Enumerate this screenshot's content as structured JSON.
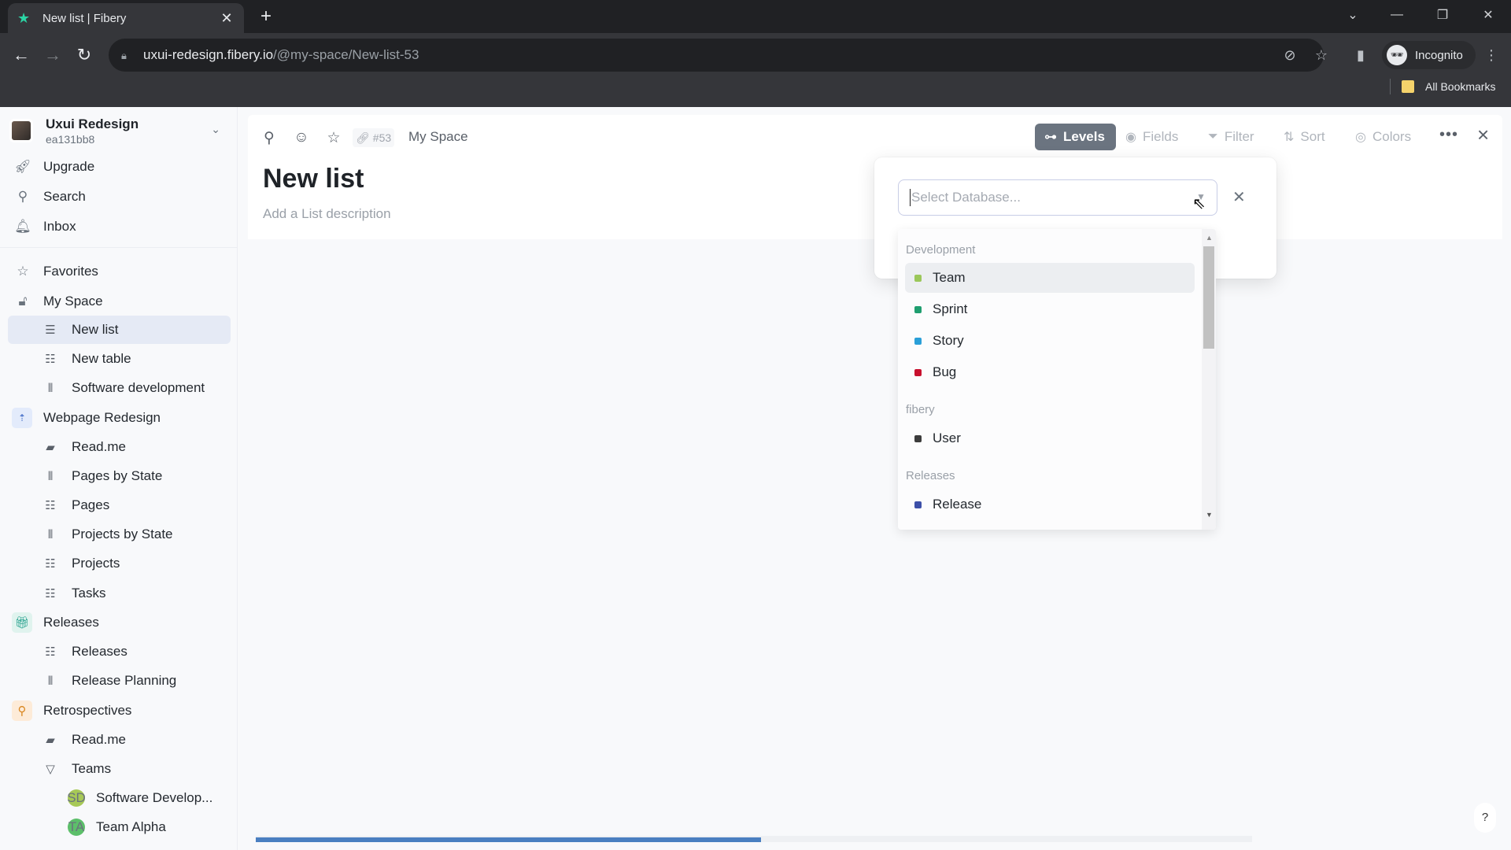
{
  "browser": {
    "tab_title": "New list | Fibery",
    "tab_favicon": "fibery-star-icon",
    "url_host": "uxui-redesign.fibery.io",
    "url_path": "/@my-space/New-list-53",
    "profile_label": "Incognito",
    "bookmarks_label": "All Bookmarks"
  },
  "sidebar": {
    "workspace_name": "Uxui Redesign",
    "workspace_id": "ea131bb8",
    "top_items": [
      {
        "label": "Upgrade",
        "icon": "rocket-icon"
      },
      {
        "label": "Search",
        "icon": "search-icon"
      },
      {
        "label": "Inbox",
        "icon": "bell-icon"
      }
    ],
    "items": [
      {
        "label": "Favorites",
        "icon": "star-icon",
        "level": 0
      },
      {
        "label": "My Space",
        "icon": "lock-icon",
        "level": 0
      },
      {
        "label": "New list",
        "icon": "list-icon",
        "level": 1,
        "active": true
      },
      {
        "label": "New table",
        "icon": "table-icon",
        "level": 1
      },
      {
        "label": "Software development",
        "icon": "board-icon",
        "level": 1
      },
      {
        "label": "Webpage Redesign",
        "icon": "space-icon",
        "level": 0
      },
      {
        "label": "Read.me",
        "icon": "document-icon",
        "level": 1
      },
      {
        "label": "Pages by State",
        "icon": "board-icon",
        "level": 1
      },
      {
        "label": "Pages",
        "icon": "table-icon",
        "level": 1
      },
      {
        "label": "Projects by State",
        "icon": "board-icon",
        "level": 1
      },
      {
        "label": "Projects",
        "icon": "table-icon",
        "level": 1
      },
      {
        "label": "Tasks",
        "icon": "table-icon",
        "level": 1
      },
      {
        "label": "Releases",
        "icon": "gift-icon",
        "level": 0
      },
      {
        "label": "Releases",
        "icon": "table-icon",
        "level": 1
      },
      {
        "label": "Release Planning",
        "icon": "board-icon",
        "level": 1
      },
      {
        "label": "Retrospectives",
        "icon": "retro-icon",
        "level": 0
      },
      {
        "label": "Read.me",
        "icon": "document-icon",
        "level": 1
      },
      {
        "label": "Teams",
        "icon": "triangle-down-icon",
        "level": 1
      },
      {
        "label": "Software Develop...",
        "icon": "avatar-SD",
        "initials": "SD",
        "level": 2
      },
      {
        "label": "Team Alpha",
        "icon": "avatar-TA",
        "initials": "TA",
        "level": 2
      }
    ]
  },
  "topbar": {
    "entity_id": "#53",
    "breadcrumb": "My Space",
    "view_buttons": [
      "Levels",
      "Fields",
      "Filter",
      "Sort",
      "Colors"
    ]
  },
  "page": {
    "title": "New list",
    "description_placeholder": "Add a List description"
  },
  "popover": {
    "input_placeholder": "Select Database...",
    "input_value": "",
    "groups": [
      {
        "label": "Development",
        "options": [
          {
            "label": "Team",
            "color": "#9bc75a",
            "hover": true
          },
          {
            "label": "Sprint",
            "color": "#1f9e6f"
          },
          {
            "label": "Story",
            "color": "#2a9fd8"
          },
          {
            "label": "Bug",
            "color": "#c8102e"
          }
        ]
      },
      {
        "label": "fibery",
        "options": [
          {
            "label": "User",
            "color": "#3c3c3c"
          }
        ]
      },
      {
        "label": "Releases",
        "options": [
          {
            "label": "Release",
            "color": "#3c4fa8"
          }
        ]
      }
    ]
  },
  "loading_progress": 0.507,
  "help_label": "?"
}
